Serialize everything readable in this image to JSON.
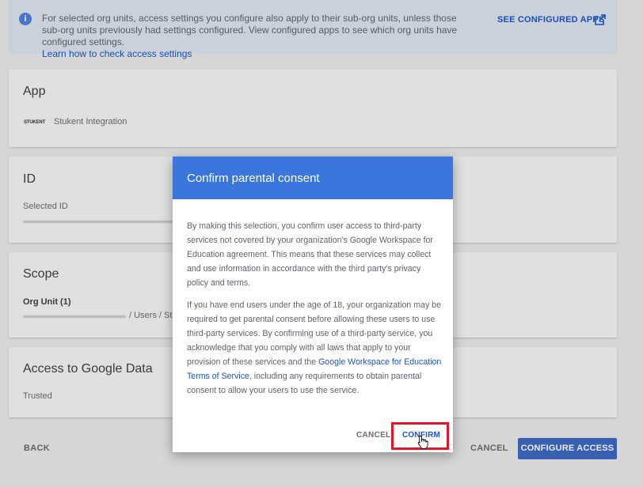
{
  "banner": {
    "info_icon": "i",
    "line1": "For selected org units, access settings you configure also apply to their sub-org units, unless those sub-org units",
    "line2": "previously had settings configured. View configured apps to see which org units have configured settings.",
    "link": "Learn how to check access settings",
    "see_apps": "SEE CONFIGURED APPS"
  },
  "cards": {
    "app": {
      "title": "App",
      "logo_text": "STUKENT",
      "app_name": "Stukent Integration"
    },
    "id": {
      "title": "ID",
      "label": "Selected ID"
    },
    "scope": {
      "title": "Scope",
      "label": "Org Unit (1)",
      "path_fragment": "/ Users / St"
    },
    "access": {
      "title": "Access to Google Data",
      "value": "Trusted"
    }
  },
  "footer": {
    "back": "BACK",
    "cancel": "CANCEL",
    "configure": "CONFIGURE ACCESS"
  },
  "dialog": {
    "title": "Confirm parental consent",
    "para1": "By making this selection, you confirm user access to third-party services not covered by your organization's Google Workspace for Education agreement. This means that these services may collect and use information in accordance with the third party's privacy policy and terms.",
    "para2_part1": "If you have end users under the age of 18, your organization may be required to get parental consent before allowing these users to use third-party services. By confirming use of a third-party service, you acknowledge that you comply with all laws that apply to your provision of these services and the ",
    "para2_link": "Google Workspace for Education Terms of Service",
    "para2_part2": ", including any requirements to obtain parental consent to allow your users to use the service.",
    "cancel": "CANCEL",
    "confirm": "CONFIRM"
  },
  "colors": {
    "accent": "#3a76db",
    "highlight": "#e0162b",
    "link": "#1a56c8"
  }
}
